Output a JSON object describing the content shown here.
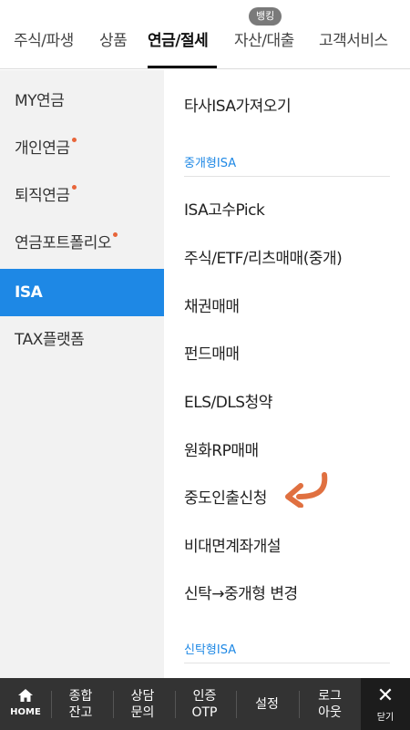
{
  "top_tabs": {
    "stocks": "주식/파생",
    "products": "상품",
    "pension": "연금/절세",
    "assets": "자산/대출",
    "service": "고객서비스",
    "banking_badge": "뱅킹"
  },
  "sidebar": {
    "items": [
      {
        "label": "MY연금",
        "dot": false
      },
      {
        "label": "개인연금",
        "dot": true
      },
      {
        "label": "퇴직연금",
        "dot": true
      },
      {
        "label": "연금포트폴리오",
        "dot": true
      },
      {
        "label": "ISA",
        "active": true
      },
      {
        "label": "TAX플랫폼",
        "dot": false
      }
    ]
  },
  "content": {
    "transfer": "타사ISA가져오기",
    "section_broker": "중개형ISA",
    "items": [
      "ISA고수Pick",
      "주식/ETF/리츠매매(중개)",
      "채권매매",
      "펀드매매",
      "ELS/DLS청약",
      "원화RP매매",
      "중도인출신청",
      "비대면계좌개설",
      "신탁→중개형 변경"
    ],
    "section_trust": "신탁형ISA",
    "arrow_color": "#e07040"
  },
  "bottom_bar": {
    "home": "HOME",
    "summary_line1": "종합",
    "summary_line2": "잔고",
    "consult_line1": "상담",
    "consult_line2": "문의",
    "otp_line1": "인증",
    "otp_line2": "OTP",
    "settings": "설정",
    "logout_line1": "로그",
    "logout_line2": "아웃",
    "close": "닫기"
  },
  "colors": {
    "accent": "#1e88e5",
    "dot": "#e8653a",
    "bottom_bar": "#333333"
  }
}
